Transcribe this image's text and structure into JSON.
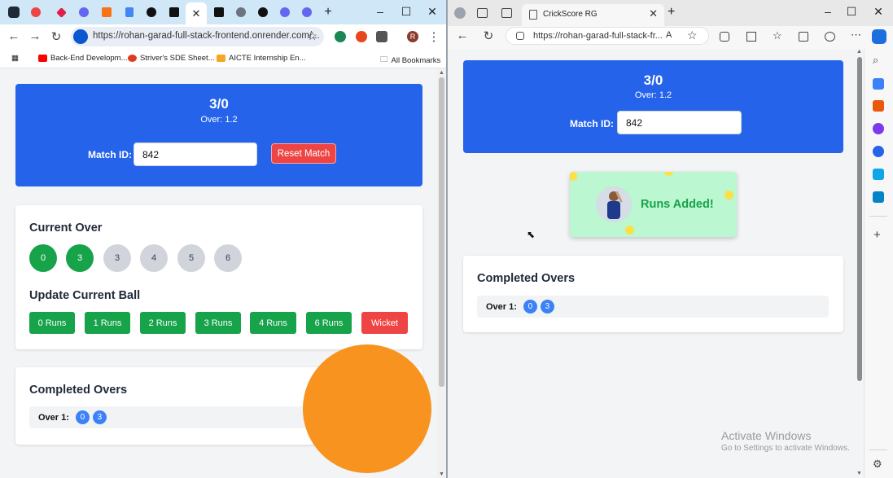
{
  "left_browser": {
    "tabs": [
      {
        "icon": "tab-list-icon"
      },
      {
        "icon": "record-icon"
      },
      {
        "icon": "diamond-icon"
      },
      {
        "icon": "gear-icon"
      },
      {
        "icon": "app-icon"
      },
      {
        "icon": "docs-icon"
      },
      {
        "icon": "openai-icon"
      },
      {
        "icon": "puzzle-icon"
      },
      {
        "icon": "close-icon",
        "active": true
      },
      {
        "icon": "puzzle-icon"
      },
      {
        "icon": "globe-icon"
      },
      {
        "icon": "openai-icon"
      },
      {
        "icon": "gear-icon"
      },
      {
        "icon": "gear-icon"
      }
    ],
    "new_tab": "+",
    "url": "https://rohan-garad-full-stack-frontend.onrender.com/...",
    "profile_initial": "R",
    "bookmarks": [
      {
        "label": "Back-End Developm...",
        "color": "#ff0000"
      },
      {
        "label": "Striver's SDE Sheet...",
        "color": "#e03a1e"
      },
      {
        "label": "AICTE Internship En...",
        "color": "#f5a623"
      }
    ],
    "all_bookmarks": "All Bookmarks"
  },
  "left_app": {
    "score": "3/0",
    "over": "Over: 1.2",
    "match_id_label": "Match ID:",
    "match_id_value": "842",
    "reset_label": "Reset Match",
    "current_over_title": "Current Over",
    "balls": [
      {
        "value": "0",
        "state": "done"
      },
      {
        "value": "3",
        "state": "done"
      },
      {
        "value": "3",
        "state": "pending"
      },
      {
        "value": "4",
        "state": "pending"
      },
      {
        "value": "5",
        "state": "pending"
      },
      {
        "value": "6",
        "state": "pending"
      }
    ],
    "update_title": "Update Current Ball",
    "run_buttons": [
      "0 Runs",
      "1 Runs",
      "2 Runs",
      "3 Runs",
      "4 Runs",
      "6 Runs"
    ],
    "wicket_label": "Wicket",
    "completed_title": "Completed Overs",
    "completed_overs": [
      {
        "label": "Over 1:",
        "balls": [
          "0",
          "3"
        ]
      }
    ]
  },
  "right_browser": {
    "tab_title": "CrickScore RG",
    "url": "https://rohan-garad-full-stack-fr...",
    "reader_label": "A",
    "new_tab": "+"
  },
  "right_app": {
    "score": "3/0",
    "over": "Over: 1.2",
    "match_id_label": "Match ID:",
    "match_id_value": "842",
    "toast_text": "Runs Added!",
    "completed_title": "Completed Overs",
    "completed_overs": [
      {
        "label": "Over 1:",
        "balls": [
          "0",
          "3"
        ]
      }
    ]
  },
  "watermark": {
    "title": "Activate Windows",
    "subtitle": "Go to Settings to activate Windows."
  },
  "colors": {
    "primary_blue": "#2563eb",
    "success_green": "#16a34a",
    "danger_red": "#ef4444",
    "chip_blue": "#3b82f6",
    "toast_green": "#bbf7d0",
    "orange_overlay": "#f7931e"
  }
}
